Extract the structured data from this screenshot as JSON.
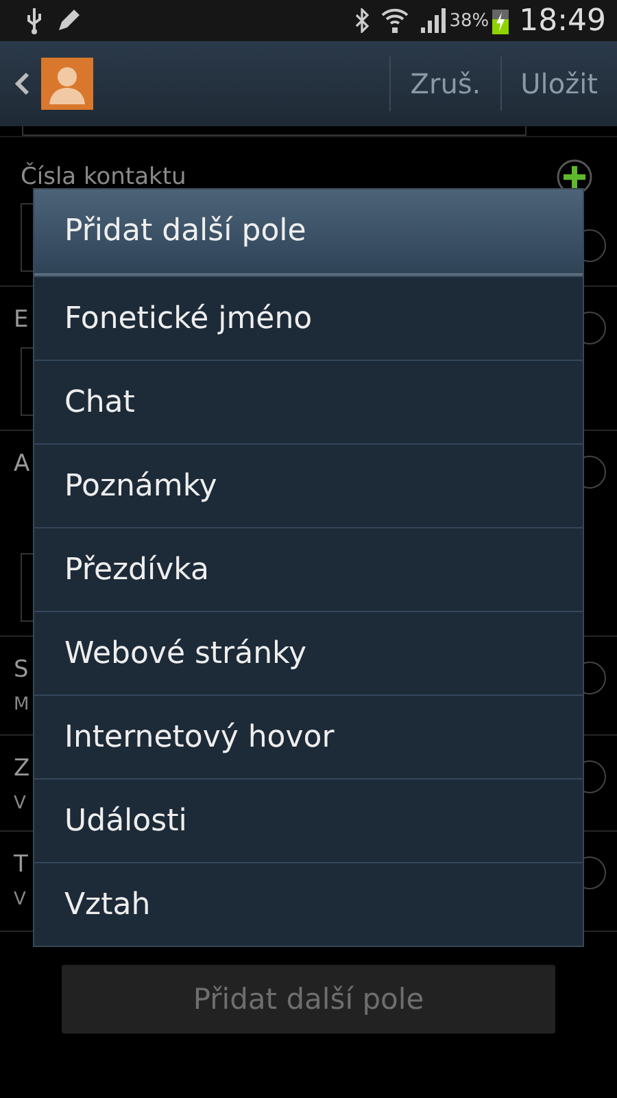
{
  "status_bar": {
    "battery": "38%",
    "charging": true,
    "time": "18:49"
  },
  "action_bar": {
    "buttons": [
      "Zruš.",
      "Uložit"
    ]
  },
  "background": {
    "section_title": "Čísla kontaktu",
    "rows": [
      {},
      {
        "label": "E"
      },
      {
        "label": "A"
      },
      {
        "label": "S",
        "sub": "M"
      },
      {
        "label": "Z",
        "sub": "V"
      },
      {
        "label": "T",
        "sub": "V"
      }
    ]
  },
  "dialog": {
    "title": "Přidat další pole",
    "items": [
      "Fonetické jméno",
      "Chat",
      "Poznámky",
      "Přezdívka",
      "Webové stránky",
      "Internetový hovor",
      "Události",
      "Vztah"
    ]
  },
  "add_button": {
    "label": "Přidat další pole",
    "disabled": true
  }
}
